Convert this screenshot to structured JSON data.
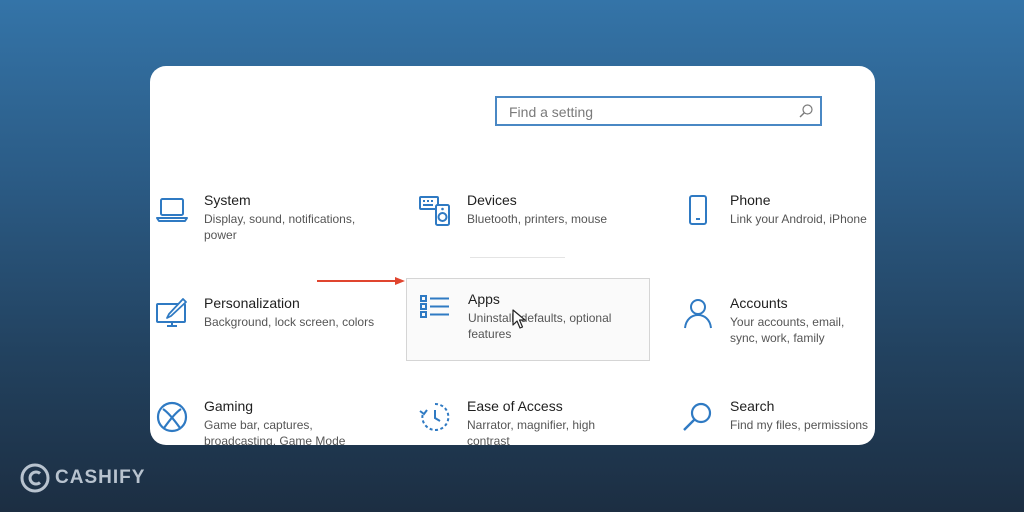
{
  "search": {
    "placeholder": "Find a setting"
  },
  "tiles": [
    {
      "title": "System",
      "description": "Display, sound, notifications, power",
      "icon": "laptop-icon"
    },
    {
      "title": "Devices",
      "description": "Bluetooth, printers, mouse",
      "icon": "keyboard-speaker-icon"
    },
    {
      "title": "Phone",
      "description": "Link your Android, iPhone",
      "icon": "phone-icon"
    },
    {
      "title": "Personalization",
      "description": "Background, lock screen, colors",
      "icon": "paint-monitor-icon"
    },
    {
      "title": "Apps",
      "description": "Uninstall, defaults, optional features",
      "icon": "apps-list-icon"
    },
    {
      "title": "Accounts",
      "description": "Your accounts, email, sync, work, family",
      "icon": "person-icon"
    },
    {
      "title": "Gaming",
      "description": "Game bar, captures, broadcasting, Game Mode",
      "icon": "xbox-icon"
    },
    {
      "title": "Ease of Access",
      "description": "Narrator, magnifier, high contrast",
      "icon": "ease-of-access-icon"
    },
    {
      "title": "Search",
      "description": "Find my files, permissions",
      "icon": "search-icon"
    }
  ],
  "colors": {
    "accent": "#0067c0",
    "arrow": "#e0452f",
    "icon": "#2f7ac3"
  },
  "brand": {
    "name": "CASHIFY"
  }
}
